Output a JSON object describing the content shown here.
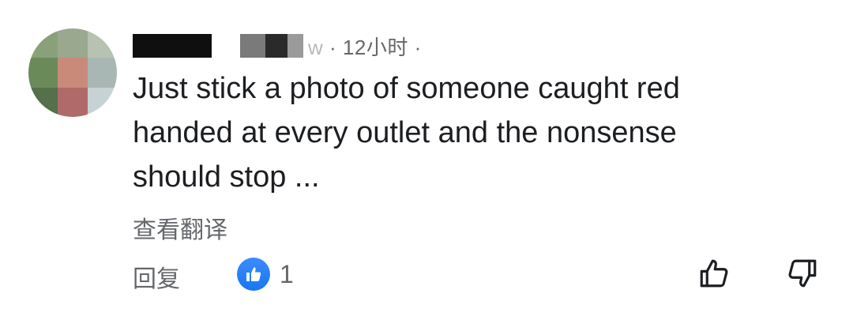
{
  "comment": {
    "author": {
      "avatar_tiles": [
        "#8aa07a",
        "#9aa890",
        "#b8c2b0",
        "#6b8a5a",
        "#c98a7a",
        "#a9b7b4",
        "#55704a",
        "#b06a6a",
        "#c7d2d4"
      ]
    },
    "meta": {
      "partial_char": "w",
      "separator": "·",
      "time": "12小时",
      "trailing_dot": "·"
    },
    "text_lines": [
      "Just stick a photo of someone caught red",
      "handed at every outlet and the nonsense",
      "should stop ..."
    ],
    "translate_label": "查看翻译",
    "actions": {
      "reply_label": "回复",
      "like_count": "1"
    }
  },
  "colors": {
    "like_blue": "#1877f2",
    "secondary_text": "#65676b",
    "primary_text": "#1c1e21",
    "icon_stroke": "#1c1e21"
  },
  "icons": {
    "reaction": "thumbs-up-icon",
    "upvote": "thumbs-up-outline-icon",
    "downvote": "thumbs-down-outline-icon"
  }
}
